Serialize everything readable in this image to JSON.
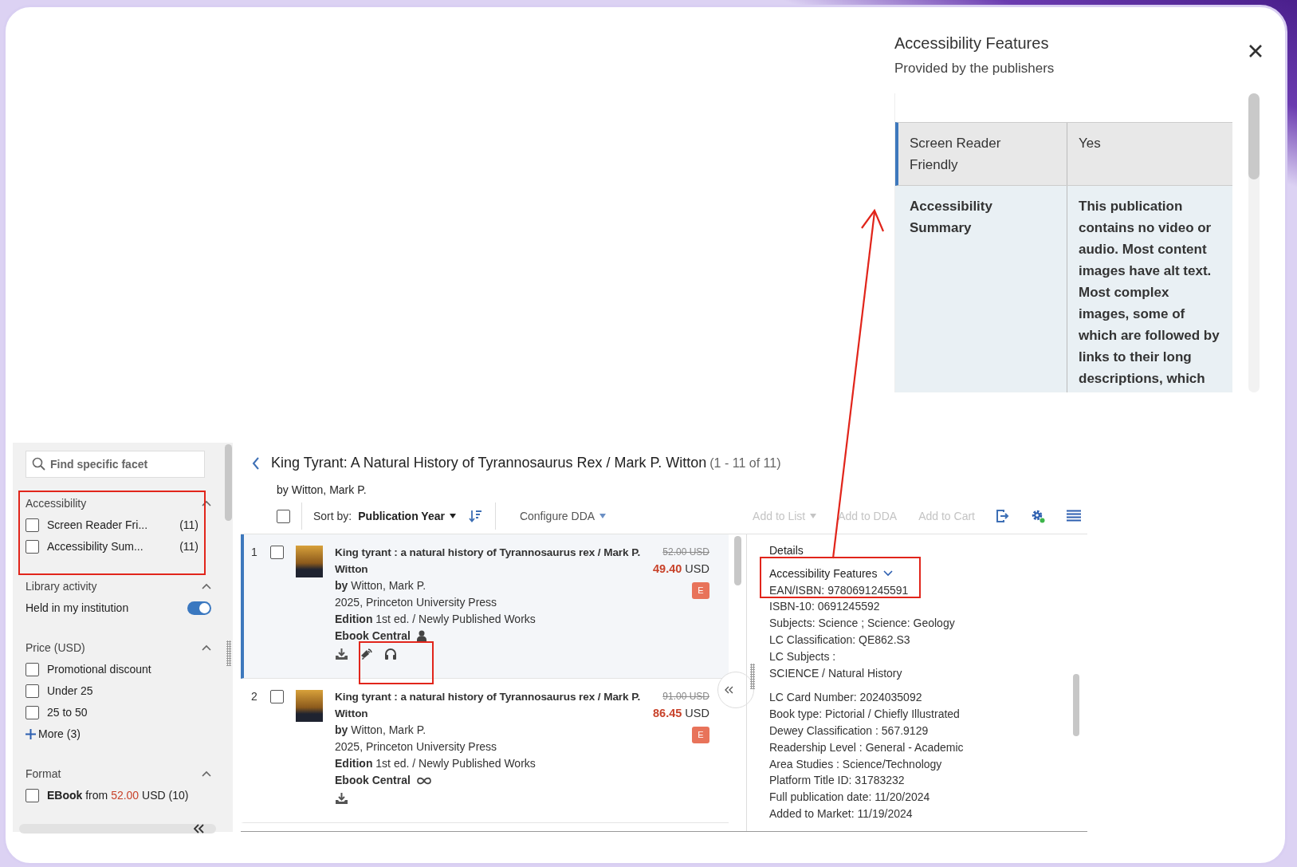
{
  "popup": {
    "title": "Accessibility Features",
    "subtitle": "Provided by the publishers",
    "rows": [
      {
        "label": "Screen Reader Friendly",
        "value": "Yes",
        "selected": true
      },
      {
        "label": "Accessibility Summary",
        "value": "This publication contains no video or audio. Most content images have alt text. Most complex images, some of which are followed by links to their long descriptions, which",
        "selected": false
      }
    ]
  },
  "sidebar": {
    "search_placeholder": "Find specific facet",
    "facets": [
      {
        "title": "Accessibility",
        "expanded": true,
        "items": [
          {
            "kind": "checkbox",
            "label": "Screen Reader Fri...",
            "count": "(11)",
            "checked": false
          },
          {
            "kind": "checkbox",
            "label": "Accessibility Sum...",
            "count": "(11)",
            "checked": false
          }
        ]
      },
      {
        "title": "Library activity",
        "expanded": true,
        "items": [
          {
            "kind": "toggle",
            "label": "Held in my institution",
            "on": true
          }
        ]
      },
      {
        "title": "Price (USD)",
        "expanded": true,
        "items": [
          {
            "kind": "checkbox",
            "label": "Promotional discount",
            "checked": false
          },
          {
            "kind": "checkbox",
            "label": "Under 25",
            "checked": false
          },
          {
            "kind": "checkbox",
            "label": "25 to 50",
            "checked": false
          },
          {
            "kind": "more",
            "label": "More (3)"
          }
        ]
      },
      {
        "title": "Format",
        "expanded": true,
        "items": [
          {
            "kind": "checkbox",
            "label": "**EBook** from",
            "price": "52.00",
            "suffix": "USD (10)",
            "checked": false
          }
        ]
      }
    ]
  },
  "header": {
    "title": "King Tyrant: A Natural History of Tyrannosaurus Rex / Mark P. Witton",
    "range": "(1 - 11 of 11)",
    "byline": "by Witton, Mark P."
  },
  "toolbar": {
    "select_all_checked": false,
    "sort_label": "Sort by:",
    "sort_value": "Publication Year",
    "configure": "Configure DDA",
    "actions": [
      {
        "label": "Add to List",
        "disabled": true,
        "dropdown": true
      },
      {
        "label": "Add to DDA",
        "disabled": true,
        "dropdown": false
      },
      {
        "label": "Add to Cart",
        "disabled": true,
        "dropdown": false
      }
    ]
  },
  "results": [
    {
      "number": "1",
      "checked": false,
      "selected": true,
      "title": "King tyrant : a natural history of Tyrannosaurus rex / Mark P. Witton",
      "author_label": "by",
      "author": "Witton, Mark P.",
      "published": "2025, Princeton University Press",
      "edition_label": "Edition",
      "edition": "1st ed. / Newly Published Works",
      "platform": "Ebook Central",
      "license": {
        "kind": "single-user"
      },
      "old_price": "52.00 USD",
      "price": "49.40",
      "currency": "USD",
      "badge": "E",
      "icons": [
        {
          "kind": "download"
        },
        {
          "kind": "read-aloud"
        },
        {
          "kind": "headphones"
        }
      ]
    },
    {
      "number": "2",
      "checked": false,
      "selected": false,
      "title": "King tyrant : a natural history of Tyrannosaurus rex / Mark P. Witton",
      "author_label": "by",
      "author": "Witton, Mark P.",
      "published": "2025, Princeton University Press",
      "edition_label": "Edition",
      "edition": "1st ed. / Newly Published Works",
      "platform": "Ebook Central",
      "license": {
        "kind": "unlimited"
      },
      "old_price": "91.00 USD",
      "price": "86.45",
      "currency": "USD",
      "badge": "E",
      "icons": [
        {
          "kind": "download"
        }
      ]
    }
  ],
  "details": {
    "heading": "Details",
    "section": "Accessibility Features",
    "expanded": false,
    "groups": [
      [
        "EAN/ISBN: 9780691245591",
        "ISBN-10: 0691245592",
        "Subjects: Science ; Science: Geology",
        "LC Classification: QE862.S3",
        "LC Subjects :",
        "SCIENCE / Natural History"
      ],
      [
        "LC Card Number: 2024035092",
        "Book type: Pictorial / Chiefly Illustrated",
        "Dewey Classification : 567.9129",
        "Readership Level : General - Academic",
        "Area Studies : Science/Technology",
        "Platform Title ID: 31783232",
        "Full publication date: 11/20/2024",
        "Added to Market: 11/19/2024"
      ]
    ]
  }
}
